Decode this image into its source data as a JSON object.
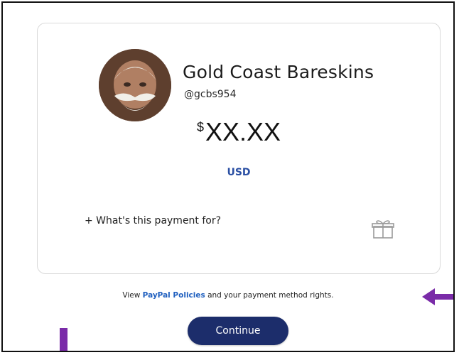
{
  "merchant": {
    "name": "Gold Coast Bareskins",
    "handle": "@gcbs954"
  },
  "payment": {
    "currency_symbol": "$",
    "amount": "XX.XX",
    "currency_code": "USD"
  },
  "note": {
    "label": "+ What's this payment for?"
  },
  "policy": {
    "prefix": "View",
    "link_text": "PayPal Policies",
    "suffix": "and your payment method rights."
  },
  "actions": {
    "continue_label": "Continue"
  },
  "icons": {
    "avatar": "merchant-avatar",
    "gift": "gift-icon",
    "annotation_arrow": "left-arrow-icon"
  },
  "colors": {
    "accent_blue": "#2a4fa3",
    "link_blue": "#1f5fbf",
    "button_navy": "#1c2d6b",
    "annotation_purple": "#7a2ba8"
  }
}
